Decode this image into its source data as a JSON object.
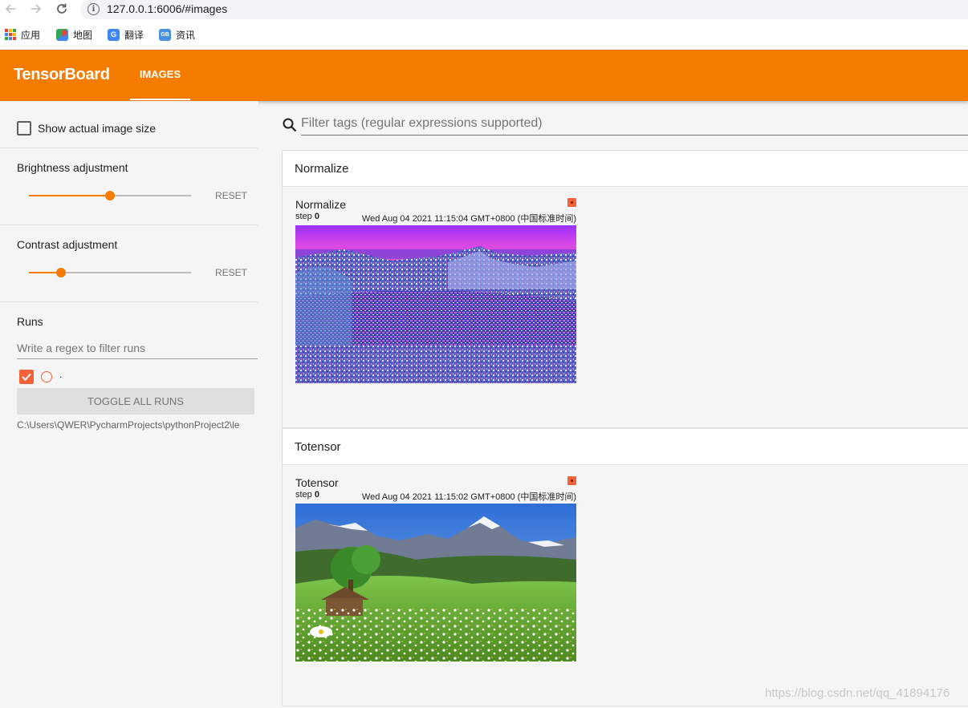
{
  "browser": {
    "url": "127.0.0.1:6006/#images",
    "back_icon": "arrow-left-icon",
    "forward_icon": "arrow-right-icon",
    "reload_icon": "reload-icon",
    "info_icon": "info-icon",
    "bookmarks": [
      {
        "label": "应用",
        "icon": "apps-icon"
      },
      {
        "label": "地图",
        "icon": "maps-icon"
      },
      {
        "label": "翻译",
        "icon": "translate-icon"
      },
      {
        "label": "资讯",
        "icon": "news-icon"
      }
    ]
  },
  "header": {
    "brand": "TensorBoard",
    "active_tab": "IMAGES",
    "color": "#f57c00"
  },
  "sidebar": {
    "show_actual_size_label": "Show actual image size",
    "show_actual_size_checked": false,
    "brightness": {
      "label": "Brightness adjustment",
      "reset": "RESET",
      "value_fraction": 0.5
    },
    "contrast": {
      "label": "Contrast adjustment",
      "reset": "RESET",
      "value_fraction": 0.2
    },
    "runs": {
      "title": "Runs",
      "filter_placeholder": "Write a regex to filter runs",
      "items": [
        {
          "name": ".",
          "checked": true,
          "color": "#f4623a"
        }
      ],
      "toggle_label": "TOGGLE ALL RUNS",
      "path": "C:\\Users\\QWER\\PycharmProjects\\pythonProject2\\le"
    }
  },
  "main": {
    "tag_filter_placeholder": "Filter tags (regular expressions supported)",
    "categories": [
      {
        "name": "Normalize",
        "card": {
          "title": "Normalize",
          "step_label": "step",
          "step": "0",
          "time": "Wed Aug 04 2021 11:15:04 GMT+0800 (中国标准时间)"
        }
      },
      {
        "name": "Totensor",
        "card": {
          "title": "Totensor",
          "step_label": "step",
          "step": "0",
          "time": "Wed Aug 04 2021 11:15:02 GMT+0800 (中国标准时间)"
        }
      }
    ]
  },
  "watermark": "https://blog.csdn.net/qq_41894176"
}
